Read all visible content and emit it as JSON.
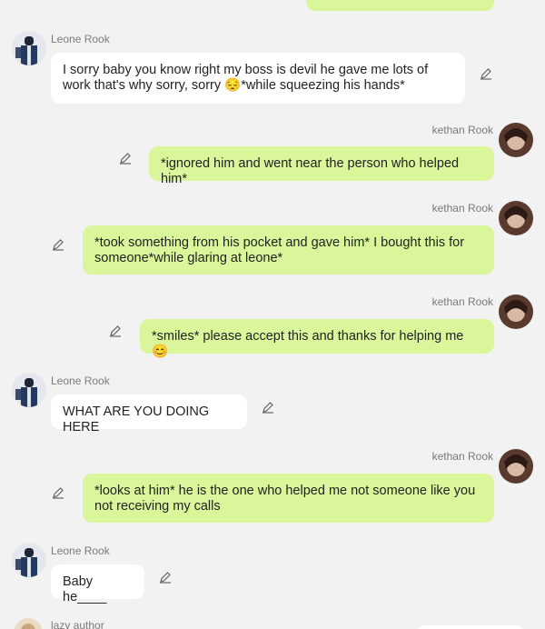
{
  "chat": {
    "top_bubble_fragment": "",
    "messages": [
      {
        "sender": "Leone Rook",
        "side": "left",
        "text": "I sorry baby you know right my boss is devil he gave me lots of work that's why sorry, sorry 😔*while squeezing his hands*"
      },
      {
        "sender": "kethan Rook",
        "side": "right",
        "text": "*ignored him and went near the person who helped him*"
      },
      {
        "sender": "kethan Rook",
        "side": "right",
        "text": "*took something from his pocket and gave him* I bought this for someone*while glaring at leone*"
      },
      {
        "sender": "kethan Rook",
        "side": "right",
        "text": "*smiles* please accept this and thanks for helping me 😊"
      },
      {
        "sender": "Leone Rook",
        "side": "left",
        "text": "WHAT ARE YOU DOING HERE"
      },
      {
        "sender": "kethan Rook",
        "side": "right",
        "text": "*looks at him* he is the one who helped me not someone like you not receiving my calls"
      },
      {
        "sender": "Leone Rook",
        "side": "left",
        "text": "Baby he____"
      },
      {
        "sender": "lazy author",
        "side": "left",
        "text": ""
      }
    ]
  },
  "colors": {
    "background": "#f2f2f2",
    "left_bubble": "#ffffff",
    "right_bubble": "#d9f79a",
    "name_text": "#7a7a7a"
  },
  "icons": {
    "edit": "pencil-icon",
    "avatar_leone": "avatar-leone",
    "avatar_kethan": "avatar-kethan",
    "avatar_author": "avatar-author"
  }
}
